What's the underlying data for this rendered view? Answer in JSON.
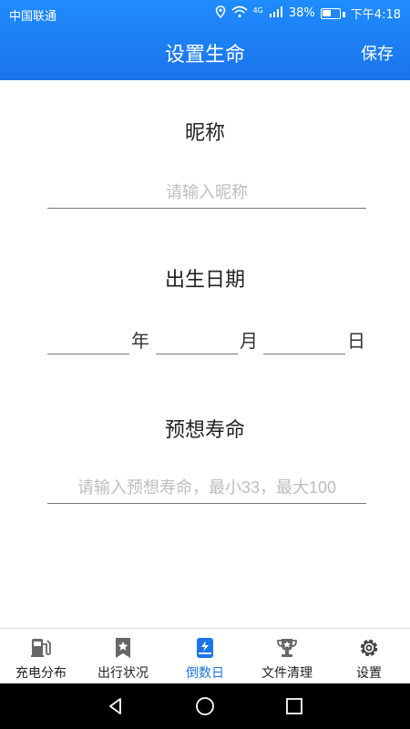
{
  "status_bar": {
    "carrier": "中国联通",
    "battery": "38%",
    "time": "下午4:18",
    "network": "4G"
  },
  "appbar": {
    "title": "设置生命",
    "save_label": "保存"
  },
  "sections": {
    "nickname": {
      "title": "昵称",
      "placeholder": "请输入昵称",
      "value": ""
    },
    "birthdate": {
      "title": "出生日期",
      "year_label": "年",
      "month_label": "月",
      "day_label": "日",
      "year_value": "",
      "month_value": "",
      "day_value": ""
    },
    "lifespan": {
      "title": "预想寿命",
      "placeholder": "请输入预想寿命，最小33，最大100",
      "value": ""
    }
  },
  "bottom_nav": {
    "items": [
      {
        "label": "充电分布",
        "icon": "fuel-pump-icon",
        "active": false
      },
      {
        "label": "出行状况",
        "icon": "bookmark-star-icon",
        "active": false
      },
      {
        "label": "倒数日",
        "icon": "lightning-book-icon",
        "active": true
      },
      {
        "label": "文件清理",
        "icon": "trophy-icon",
        "active": false
      },
      {
        "label": "设置",
        "icon": "gear-icon",
        "active": false
      }
    ]
  },
  "system_nav": {
    "buttons": [
      "back-icon",
      "home-icon",
      "recents-icon"
    ]
  },
  "colors": {
    "primary": "#1a74ea",
    "inactive_icon": "#666666",
    "divider": "#777777",
    "placeholder": "#bdbdbd"
  }
}
